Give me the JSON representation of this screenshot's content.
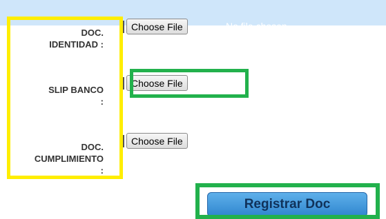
{
  "form": {
    "no_file_text": "No file chosen",
    "fields": [
      {
        "label_lines": [
          "DOC.",
          "IDENTIDAD :"
        ],
        "button_label": "Choose File"
      },
      {
        "label_lines": [
          "SLIP BANCO",
          ":"
        ],
        "button_label": "Choose File"
      },
      {
        "label_lines": [
          "DOC.",
          "CUMPLIMIENTO",
          ":"
        ],
        "button_label": "Choose File"
      }
    ],
    "submit_label": "Registrar Doc"
  },
  "colors": {
    "highlight_yellow": "#ffee00",
    "highlight_green": "#22b14c",
    "submit_blue": "#3a8fd6",
    "top_band": "#cfe6fa"
  }
}
